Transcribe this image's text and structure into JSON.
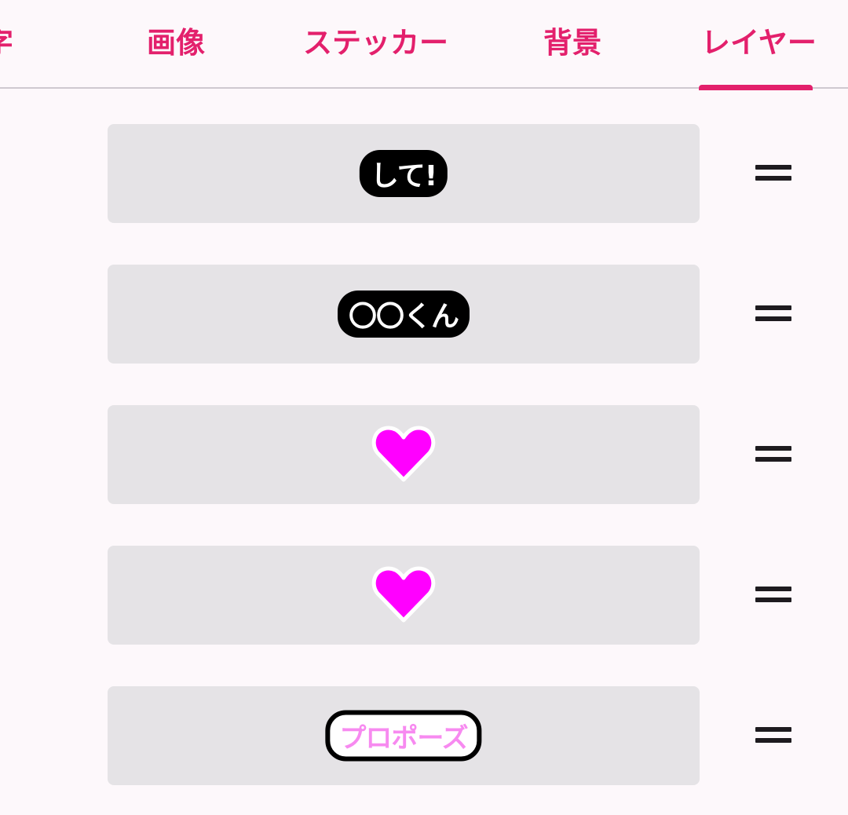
{
  "tabs": [
    {
      "label": "字"
    },
    {
      "label": "画像"
    },
    {
      "label": "ステッカー"
    },
    {
      "label": "背景"
    },
    {
      "label": "レイヤー"
    }
  ],
  "active_tab": "レイヤー",
  "colors": {
    "accent": "#e3206c",
    "card_bg": "#e5e3e6",
    "heart": "#ff00ff",
    "pink_text": "#f78af0"
  },
  "layers": [
    {
      "type": "text-sticker",
      "text": "して!",
      "handle_icon": "drag-handle-icon"
    },
    {
      "type": "text-sticker",
      "text": "〇〇くん",
      "handle_icon": "drag-handle-icon"
    },
    {
      "type": "heart-sticker",
      "icon": "heart-icon",
      "handle_icon": "drag-handle-icon"
    },
    {
      "type": "heart-sticker",
      "icon": "heart-icon",
      "handle_icon": "drag-handle-icon"
    },
    {
      "type": "text-sticker",
      "text": "プロポーズ",
      "handle_icon": "drag-handle-icon"
    }
  ]
}
